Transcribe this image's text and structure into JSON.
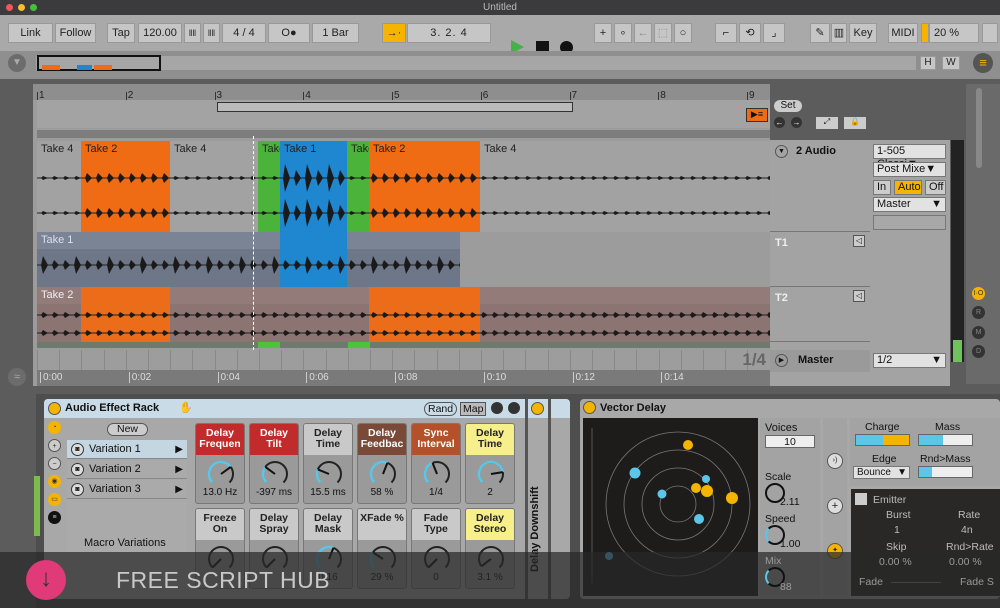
{
  "window": {
    "title": "Untitled"
  },
  "toolbar": {
    "link": "Link",
    "follow": "Follow",
    "tap": "Tap",
    "tempo": "120.00",
    "signature": "4 / 4",
    "metronome": "O●",
    "quantize": "1 Bar",
    "position": "3.  2.  4",
    "key": "Key",
    "midi": "MIDI",
    "cpu": "20 %",
    "icons": [
      "play-icon",
      "stop-icon",
      "record-icon",
      "add-icon",
      "automation-arm-icon",
      "back-to-arrangement-icon",
      "capture-icon",
      "session-record-icon",
      "draw-curve-icon",
      "loop-icon",
      "punch-out-icon",
      "pencil-icon",
      "keyboard-icon"
    ],
    "accent": "#f5b400"
  },
  "overview": {
    "h": "H",
    "w": "W"
  },
  "arrangement": {
    "bars": [
      "1",
      "2",
      "3",
      "4",
      "5",
      "6",
      "7",
      "8",
      "9"
    ],
    "set_label": "Set",
    "times": [
      "0:00",
      "0:02",
      "0:04",
      "0:06",
      "0:08",
      "0:10",
      "0:12",
      "0:14"
    ],
    "zoom_label": "1/4",
    "main_lane": [
      {
        "label": "Take 4",
        "color": "#a2a2a2"
      },
      {
        "label": "Take 2",
        "color": "#f06c14"
      },
      {
        "label": "Take 4",
        "color": "#a2a2a2"
      },
      {
        "label": "Take",
        "color": "#4cb33a"
      },
      {
        "label": "Take 1",
        "color": "#1f86d0"
      },
      {
        "label": "Take",
        "color": "#4cb33a"
      },
      {
        "label": "Take 2",
        "color": "#f06c14"
      },
      {
        "label": "Take 4",
        "color": "#a2a2a2"
      }
    ],
    "take1_label": "Take 1",
    "take2_label": "Take 2"
  },
  "tracks": {
    "audio": "2 Audio",
    "t1": "T1",
    "t2": "T2",
    "master": "Master"
  },
  "mixer": {
    "input": "1-505 Classi▼",
    "input_channel": "Post Mixe▼",
    "monitor": [
      "In",
      "Auto",
      "Off"
    ],
    "output": "Master",
    "master_out": "1/2"
  },
  "sidebar": {
    "buttons": [
      "I·O",
      "R",
      "M",
      "D"
    ]
  },
  "rack": {
    "title": "Audio Effect Rack",
    "rand": "Rand",
    "map": "Map",
    "new": "New",
    "variations": [
      "Variation 1",
      "Variation 2",
      "Variation 3"
    ],
    "variations_label": "Macro Variations",
    "macros": [
      {
        "name": "Delay\nFrequen",
        "value": "13.0 Hz",
        "color": "#c22b2b",
        "text": "#fff",
        "level": 0.7
      },
      {
        "name": "Delay\nTilt",
        "value": "-397 ms",
        "color": "#c22b2b",
        "text": "#fff",
        "level": 0.3
      },
      {
        "name": "Delay\nTime",
        "value": "15.5 ms",
        "color": "#c9c9c9",
        "text": "#222",
        "level": 0.25
      },
      {
        "name": "Delay\nFeedbac",
        "value": "58 %",
        "color": "#7a4a38",
        "text": "#fff",
        "level": 0.58
      },
      {
        "name": "Sync\nInterval",
        "value": "1/4",
        "color": "#b4502a",
        "text": "#fff",
        "level": 0.42
      },
      {
        "name": "Delay\nTime",
        "value": "2",
        "color": "#f6ef8a",
        "text": "#222",
        "level": 0.8
      },
      {
        "name": "Freeze\nOn",
        "value": "",
        "color": "#c9c9c9",
        "text": "#222",
        "level": 0
      },
      {
        "name": "Delay\nSpray",
        "value": "",
        "color": "#c9c9c9",
        "text": "#222",
        "level": 0
      },
      {
        "name": "Delay\nMask",
        "value": "0.16",
        "color": "#c9c9c9",
        "text": "#222",
        "level": 0.58
      },
      {
        "name": "XFade %",
        "value": "29 %",
        "color": "#c9c9c9",
        "text": "#222",
        "level": 0.29
      },
      {
        "name": "Fade\nType",
        "value": "0",
        "color": "#c9c9c9",
        "text": "#222",
        "level": 0
      },
      {
        "name": "Delay\nStereo",
        "value": "3.1 %",
        "color": "#f6ef8a",
        "text": "#222",
        "level": 0.03
      }
    ],
    "chain_name": "Delay Downshift"
  },
  "vector_delay": {
    "title": "Vector Delay",
    "voices_label": "Voices",
    "voices": "10",
    "scale_label": "Scale",
    "scale": "2.11",
    "speed_label": "Speed",
    "speed": "1.00",
    "mix_label": "Mix",
    "mix": "88",
    "charge_label": "Charge",
    "mass_label": "Mass",
    "edge_label": "Edge",
    "edge": "Bounce",
    "rnd_mass_label": "Rnd>Mass",
    "emitter_label": "Emitter",
    "burst_label": "Burst",
    "burst": "1",
    "rate_label": "Rate",
    "rate": "4n",
    "skip_label": "Skip",
    "skip": "0.00 %",
    "rnd_rate_label": "Rnd>Rate",
    "rnd_rate": "0.00 %",
    "fade_label": "Fade",
    "fade_s_label": "Fade S",
    "charge_level": 0.5,
    "mass_level": 0.45,
    "rnd_mass_level": 0.25
  },
  "watermark": "FREE SCRIPT HUB"
}
